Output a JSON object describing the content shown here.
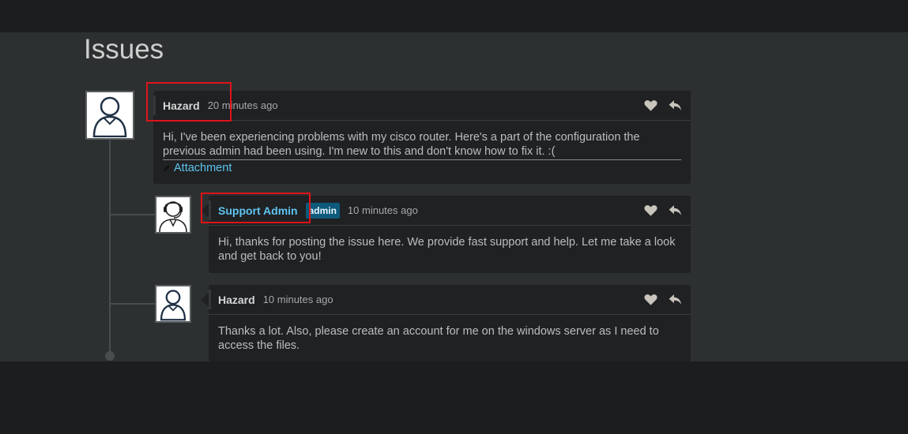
{
  "page": {
    "title": "Issues"
  },
  "comments": [
    {
      "author": "Hazard",
      "time": "20 minutes ago",
      "body": "Hi, I've been experiencing problems with my cisco router. Here's a part of the configuration the previous admin had been using. I'm new to this and don't know how to fix it. :(",
      "attachment": "Attachment",
      "avatar": "user-outline-avatar"
    },
    {
      "author": "Support Admin",
      "badge": "admin",
      "time": "10 minutes ago",
      "body": "Hi, thanks for posting the issue here. We provide fast support and help. Let me take a look and get back to you!",
      "avatar": "support-agent-avatar"
    },
    {
      "author": "Hazard",
      "time": "10 minutes ago",
      "body": "Thanks a lot. Also, please create an account for me on the windows server as I need to access the files.",
      "avatar": "user-outline-avatar"
    }
  ],
  "icons": {
    "like": "heart-icon",
    "reply": "reply-icon",
    "attachment": "pencil-icon"
  },
  "colors": {
    "background": "#2d3031",
    "card": "#1f2123",
    "accent": "#5fc5f0",
    "badge": "#0d5a7c",
    "highlight": "#e0131a"
  }
}
